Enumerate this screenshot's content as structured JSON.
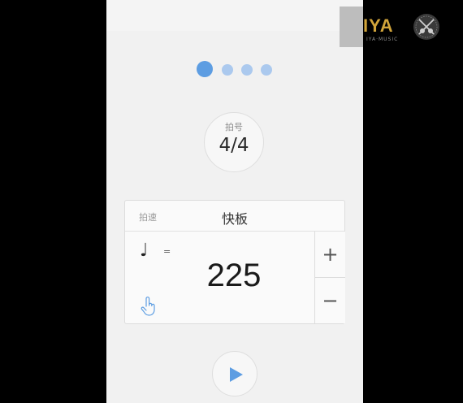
{
  "pager": {
    "count": 4,
    "active_index": 0,
    "colors": {
      "active": "#5d9de2",
      "inactive": "#abc9ee"
    }
  },
  "time_signature": {
    "label": "拍号",
    "value": "4/4"
  },
  "tempo": {
    "caption": "拍速",
    "marking": "快板",
    "note_icon": "quarter-note-icon",
    "equals": "=",
    "bpm": "225",
    "tap_icon": "tap-hand-icon",
    "plus": "+",
    "minus": "−"
  },
  "controls": {
    "play_icon": "play-icon",
    "accent": "#5d9de2"
  },
  "watermark": {
    "brand": "IYA",
    "sub": "IYA·MUSIC"
  }
}
